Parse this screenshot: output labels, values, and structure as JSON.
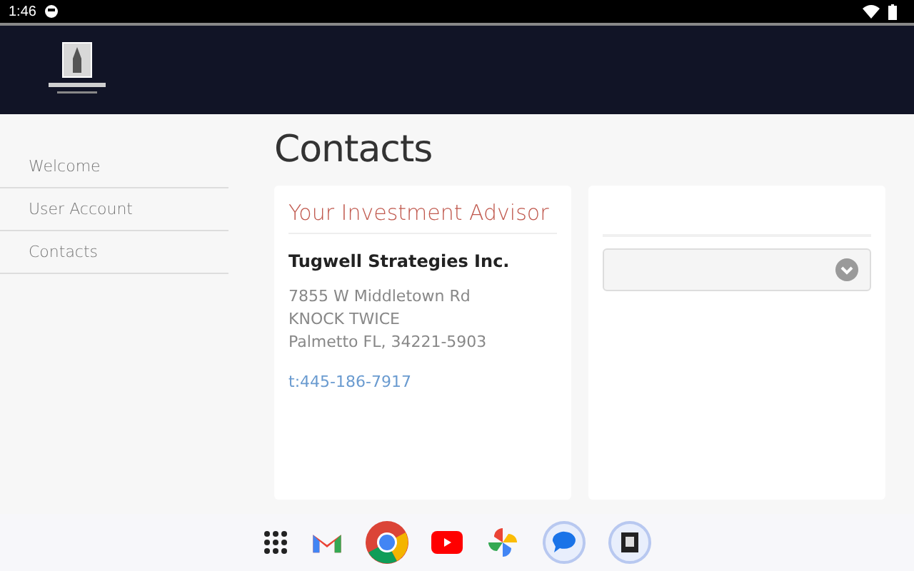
{
  "status_bar": {
    "time": "1:46"
  },
  "sidebar": {
    "items": [
      {
        "label": "Welcome"
      },
      {
        "label": "User Account"
      },
      {
        "label": "Contacts"
      }
    ]
  },
  "page": {
    "title": "Contacts"
  },
  "advisor_card": {
    "heading": "Your Investment Advisor",
    "company": "Tugwell Strategies Inc.",
    "address_lines": [
      "7855 W Middletown Rd",
      "KNOCK TWICE",
      "Palmetto FL, 34221-5903"
    ],
    "phone": "t:445-186-7917"
  },
  "dock": {
    "apps": [
      {
        "kind": "grid"
      },
      {
        "kind": "mail"
      },
      {
        "kind": "browser"
      },
      {
        "kind": "video"
      },
      {
        "kind": "photos"
      },
      {
        "kind": "chat"
      },
      {
        "kind": "book"
      }
    ]
  }
}
